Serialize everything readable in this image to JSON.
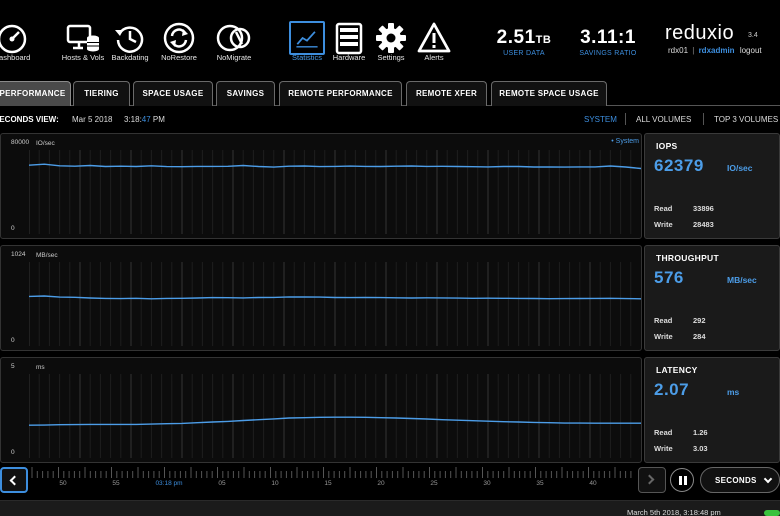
{
  "nav": [
    {
      "label": "Dashboard",
      "icon": "gauge-icon",
      "active": false
    },
    {
      "label": "Hosts & Vols",
      "icon": "monitor-database-icon",
      "active": false
    },
    {
      "label": "Backdating",
      "icon": "clock-back-icon",
      "active": false
    },
    {
      "label": "NoRestore",
      "icon": "restore-arrows-icon",
      "active": false
    },
    {
      "label": "NoMigrate",
      "icon": "migrate-icon",
      "active": false
    },
    {
      "label": "Statistics",
      "icon": "line-chart-icon",
      "active": true
    },
    {
      "label": "Hardware",
      "icon": "server-rack-icon",
      "active": false
    },
    {
      "label": "Settings",
      "icon": "gear-icon",
      "active": false
    },
    {
      "label": "Alerts",
      "icon": "warning-icon",
      "active": false
    }
  ],
  "header_stats": {
    "user_data_value": "2.51",
    "user_data_unit": "TB",
    "user_data_label": "USER DATA",
    "savings_value": "3.11:1",
    "savings_label": "SAVINGS RATIO"
  },
  "brand": {
    "logo": "reduxio",
    "version": "3.4",
    "system": "rdx01",
    "separator": "|",
    "user": "rdxadmin",
    "logout": "logout"
  },
  "tabs": [
    {
      "label": "PERFORMANCE",
      "active": true
    },
    {
      "label": "TIERING",
      "active": false
    },
    {
      "label": "SPACE USAGE",
      "active": false
    },
    {
      "label": "SAVINGS",
      "active": false
    },
    {
      "label": "REMOTE PERFORMANCE",
      "active": false
    },
    {
      "label": "REMOTE XFER",
      "active": false
    },
    {
      "label": "REMOTE SPACE USAGE",
      "active": false
    }
  ],
  "view": {
    "title": "SECONDS VIEW:",
    "date": "Mar 5 2018",
    "time_prefix": "3:18:",
    "time_seconds": "47",
    "time_suffix": " PM",
    "scopes": [
      "SYSTEM",
      "ALL VOLUMES",
      "TOP 3 VOLUMES"
    ],
    "active_scope": "SYSTEM"
  },
  "charts": [
    {
      "ymax": "80000",
      "ymin": "0",
      "unit": "IO/sec",
      "legend": "• System",
      "title": "IOPS",
      "value": "62379",
      "value_unit": "IO/sec",
      "read_label": "Read",
      "read": "33896",
      "write_label": "Write",
      "write": "28483"
    },
    {
      "ymax": "1024",
      "ymin": "0",
      "unit": "MB/sec",
      "legend": "",
      "title": "THROUGHPUT",
      "value": "576",
      "value_unit": "MB/sec",
      "read_label": "Read",
      "read": "292",
      "write_label": "Write",
      "write": "284"
    },
    {
      "ymax": "5",
      "ymin": "0",
      "unit": "ms",
      "legend": "",
      "title": "LATENCY",
      "value": "2.07",
      "value_unit": "ms",
      "read_label": "Read",
      "read": "1.26",
      "write_label": "Write",
      "write": "3.03"
    }
  ],
  "chart_data": [
    {
      "type": "line",
      "ylim": [
        0,
        80000
      ],
      "ylabel": "IO/sec",
      "series": [
        {
          "name": "System",
          "color": "#4c9de8",
          "values": [
            65500,
            66500,
            65000,
            64600,
            65200,
            64300,
            64600,
            64300,
            65000,
            64200,
            64100,
            64400,
            64400,
            64500,
            65200,
            64300,
            63700,
            64600,
            64800,
            64200,
            64400,
            64700,
            64400,
            64300,
            64600,
            64800,
            64400,
            64500,
            64300,
            64100,
            63900,
            64300,
            64300,
            63800,
            63800,
            63700,
            63900,
            63900,
            64800,
            63800,
            62400
          ]
        }
      ]
    },
    {
      "type": "line",
      "ylim": [
        0,
        1024
      ],
      "ylabel": "MB/sec",
      "series": [
        {
          "name": "System",
          "color": "#4c9de8",
          "values": [
            605,
            610,
            596,
            594,
            585,
            580,
            578,
            582,
            575,
            580,
            581,
            585,
            590,
            589,
            586,
            591,
            592,
            598,
            597,
            596,
            591,
            590,
            593,
            590,
            588,
            585,
            588,
            586,
            584,
            582,
            583,
            582,
            580,
            579,
            577,
            578,
            579,
            580,
            581,
            578,
            576
          ]
        }
      ]
    },
    {
      "type": "line",
      "ylim": [
        0,
        5
      ],
      "ylabel": "ms",
      "series": [
        {
          "name": "System",
          "color": "#4c9de8",
          "values": [
            1.95,
            1.96,
            1.98,
            1.99,
            2.0,
            2.0,
            2.0,
            2.0,
            2.02,
            2.04,
            2.06,
            2.1,
            2.14,
            2.18,
            2.23,
            2.28,
            2.33,
            2.38,
            2.4,
            2.42,
            2.43,
            2.43,
            2.42,
            2.4,
            2.38,
            2.35,
            2.32,
            2.28,
            2.25,
            2.22,
            2.19,
            2.16,
            2.14,
            2.12,
            2.1,
            2.08,
            2.08,
            2.07,
            2.07,
            2.07,
            2.07
          ]
        }
      ]
    }
  ],
  "timeline": {
    "labels": [
      "50",
      "55",
      "03:18 pm",
      "05",
      "10",
      "15",
      "20",
      "25",
      "30",
      "35",
      "40"
    ],
    "current_label": "03:18 pm",
    "mode": "SECONDS"
  },
  "footer": {
    "timestamp": "March 5th 2018, 3:18:48 pm"
  }
}
